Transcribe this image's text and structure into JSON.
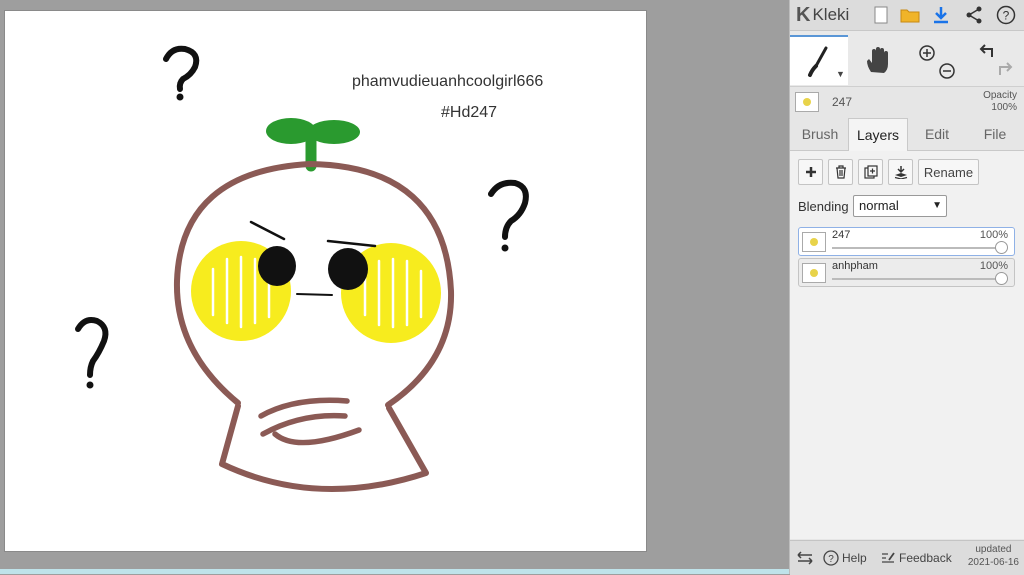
{
  "canvas": {
    "signature_name": "phamvudieuanhcoolgirl666",
    "signature_tag": "#Hd247",
    "colors": {
      "outline": "#8b5a55",
      "cheeks": "#f7ec1e",
      "sprout": "#2a9a2f",
      "ink": "#111111"
    }
  },
  "topbar": {
    "logo_mark": "K",
    "logo_text": "Kleki",
    "help_glyph": "?"
  },
  "layer_info": {
    "name": "247",
    "opacity_label": "Opacity",
    "opacity_value": "100%"
  },
  "tabs": [
    {
      "label": "Brush"
    },
    {
      "label": "Layers"
    },
    {
      "label": "Edit"
    },
    {
      "label": "File"
    }
  ],
  "layers_panel": {
    "rename_label": "Rename",
    "blending_label": "Blending",
    "blending_value": "normal",
    "layers": [
      {
        "name": "247",
        "opacity": "100%",
        "selected": true
      },
      {
        "name": "anhpham",
        "opacity": "100%",
        "selected": false
      }
    ]
  },
  "footer": {
    "help_label": "Help",
    "feedback_label": "Feedback",
    "updated_label": "updated",
    "updated_date": "2021-06-16"
  }
}
